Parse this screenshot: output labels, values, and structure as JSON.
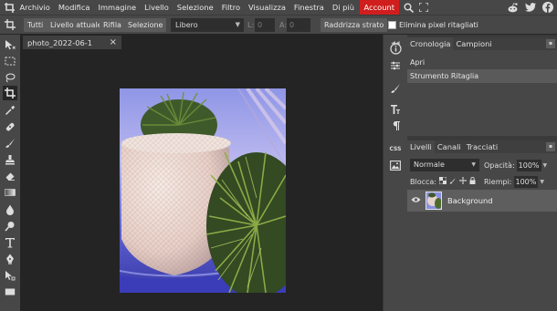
{
  "menubar": {
    "items": [
      "Archivio",
      "Modifica",
      "Immagine",
      "Livello",
      "Selezione",
      "Filtro",
      "Visualizza",
      "Finestra",
      "Di più"
    ],
    "account": "Account",
    "accent": "#d01e1e"
  },
  "options": {
    "btn_all": "Tutti",
    "btn_current_level": "Livello attuale",
    "btn_trim": "Rifila",
    "btn_selection": "Selezione",
    "mode_value": "Libero",
    "w_label": "L:",
    "w_value": "0",
    "h_label": "A:",
    "h_value": "0",
    "straighten": "Raddrizza strato",
    "delete_pixels": "Elimina pixel ritagliati"
  },
  "document": {
    "tab_label": "photo_2022-06-1",
    "close": "×"
  },
  "history_panel": {
    "tabs": [
      "Cronologia",
      "Campioni"
    ],
    "items": [
      "Apri",
      "Strumento Ritaglia"
    ]
  },
  "sidebar": {
    "css_label": "CSS"
  },
  "layers_panel": {
    "tabs": [
      "Livelli",
      "Canali",
      "Tracciati"
    ],
    "blend_mode": "Normale",
    "opacity_label": "Opacità:",
    "opacity_value": "100%",
    "lock_label": "Blocca:",
    "fill_label": "Riempi:",
    "fill_value": "100%",
    "layer_name": "Background"
  }
}
